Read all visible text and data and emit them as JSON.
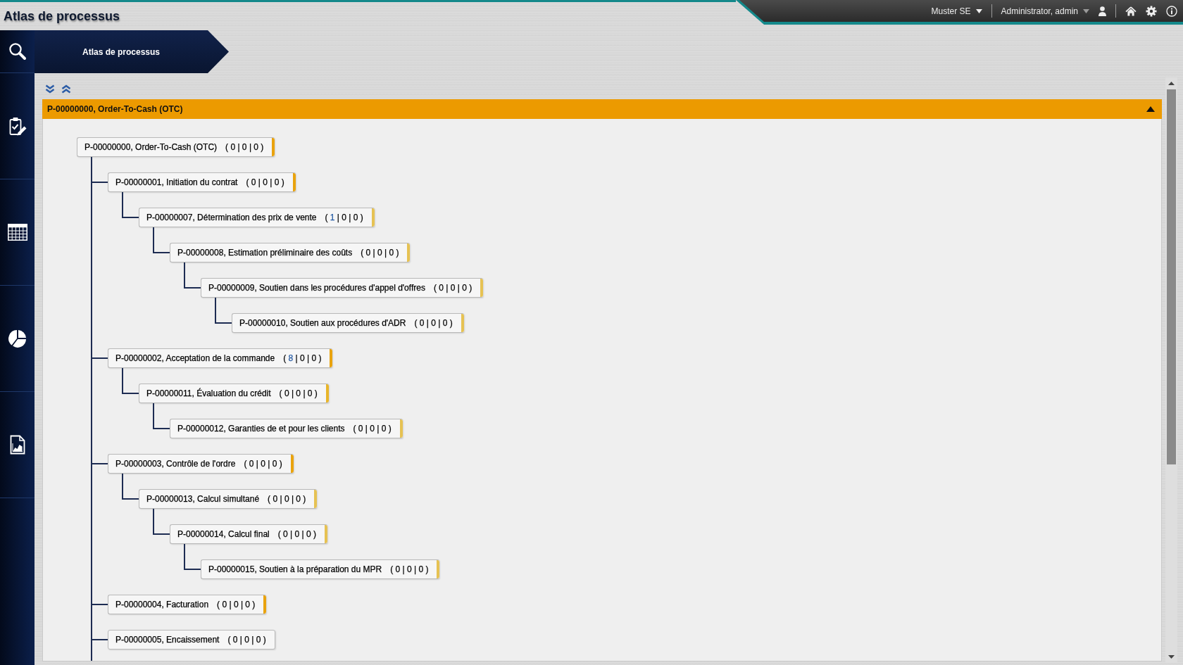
{
  "app": {
    "title": "Atlas de processus"
  },
  "top_bar": {
    "company": "Muster SE",
    "user": "Administrator, admin"
  },
  "breadcrumb": {
    "label": "Atlas de processus"
  },
  "panel": {
    "title": "P-00000000, Order-To-Cash (OTC)",
    "expanded": true,
    "tree": {
      "label": "P-00000000, Order-To-Cash (OTC)",
      "counts": [
        {
          "text": "( 0 | 0 | 0 )",
          "link": false
        }
      ],
      "color": "#e9a30e",
      "continues": true,
      "children": [
        {
          "label": "P-00000001, Initiation du contrat",
          "counts": [
            {
              "text": "( 0 | 0 | 0 )",
              "link": false
            }
          ],
          "color": "#e9a30e",
          "children": [
            {
              "label": "P-00000007, Détermination des prix de vente",
              "counts": [
                {
                  "text": "( ",
                  "link": false
                },
                {
                  "text": "1",
                  "link": true
                },
                {
                  "text": " | 0 | 0 )",
                  "link": false
                }
              ],
              "color": "#e6c253",
              "children": [
                {
                  "label": "P-00000008, Estimation préliminaire des coûts",
                  "counts": [
                    {
                      "text": "( 0 | 0 | 0 )",
                      "link": false
                    }
                  ],
                  "color": "#e6c253",
                  "children": [
                    {
                      "label": "P-00000009, Soutien dans les procédures d'appel d'offres",
                      "counts": [
                        {
                          "text": "( 0 | 0 | 0 )",
                          "link": false
                        }
                      ],
                      "color": "#e6c253",
                      "children": [
                        {
                          "label": "P-00000010, Soutien aux procédures d'ADR",
                          "counts": [
                            {
                              "text": "( 0 | 0 | 0 )",
                              "link": false
                            }
                          ],
                          "color": "#e6c253"
                        }
                      ]
                    }
                  ]
                }
              ]
            }
          ]
        },
        {
          "label": "P-00000002, Acceptation de la commande",
          "counts": [
            {
              "text": "( ",
              "link": false
            },
            {
              "text": "8",
              "link": true
            },
            {
              "text": " | 0 | 0 )",
              "link": false
            }
          ],
          "color": "#e9a30e",
          "children": [
            {
              "label": "P-00000011, Évaluation du crédit",
              "counts": [
                {
                  "text": "( 0 | 0 | 0 )",
                  "link": false
                }
              ],
              "color": "#e8b52a",
              "children": [
                {
                  "label": "P-00000012, Garanties de et pour les clients",
                  "counts": [
                    {
                      "text": "( 0 | 0 | 0 )",
                      "link": false
                    }
                  ],
                  "color": "#e6c253"
                }
              ]
            }
          ]
        },
        {
          "label": "P-00000003, Contrôle de l'ordre",
          "counts": [
            {
              "text": "( 0 | 0 | 0 )",
              "link": false
            }
          ],
          "color": "#e9a30e",
          "children": [
            {
              "label": "P-00000013, Calcul simultané",
              "counts": [
                {
                  "text": "( 0 | 0 | 0 )",
                  "link": false
                }
              ],
              "color": "#e6c253",
              "children": [
                {
                  "label": "P-00000014, Calcul final",
                  "counts": [
                    {
                      "text": "( 0 | 0 | 0 )",
                      "link": false
                    }
                  ],
                  "color": "#e6c253",
                  "children": [
                    {
                      "label": "P-00000015, Soutien à la préparation du MPR",
                      "counts": [
                        {
                          "text": "( 0 | 0 | 0 )",
                          "link": false
                        }
                      ],
                      "color": "#e6c253"
                    }
                  ]
                }
              ]
            }
          ]
        },
        {
          "label": "P-00000004, Facturation",
          "counts": [
            {
              "text": "( 0 | 0 | 0 )",
              "link": false
            }
          ],
          "color": "#e9a30e"
        },
        {
          "label": "P-00000005, Encaissement",
          "counts": [
            {
              "text": "( 0 | 0 | 0 )",
              "link": false
            }
          ]
        }
      ]
    }
  }
}
